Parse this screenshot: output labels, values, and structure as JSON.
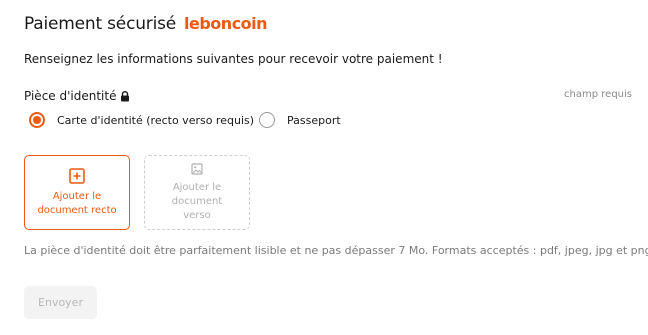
{
  "header": {
    "title": "Paiement sécurisé",
    "brand_logo": "leboncoin"
  },
  "subtitle": "Renseignez les informations suivantes pour recevoir votre paiement !",
  "identity_field": {
    "label": "Pièce d'identité",
    "required_note": "champ requis",
    "options": [
      {
        "label": "Carte d'identité (recto verso requis)",
        "selected": true
      },
      {
        "label": "Passeport",
        "selected": false
      }
    ]
  },
  "uploads": {
    "front_label": "Ajouter le document recto",
    "back_label": "Ajouter le document verso",
    "front_icon": "add-square-icon",
    "back_icon": "image-placeholder-icon"
  },
  "hint": "La pièce d'identité doit être parfaitement lisible et ne pas dépasser 7 Mo. Formats acceptés : pdf, jpeg, jpg et png",
  "submit": {
    "label": "Envoyer",
    "enabled": false
  },
  "colors": {
    "accent": "#ec5a13",
    "muted_text": "#7a7a7a",
    "disabled_bg": "#f3f3f3"
  }
}
